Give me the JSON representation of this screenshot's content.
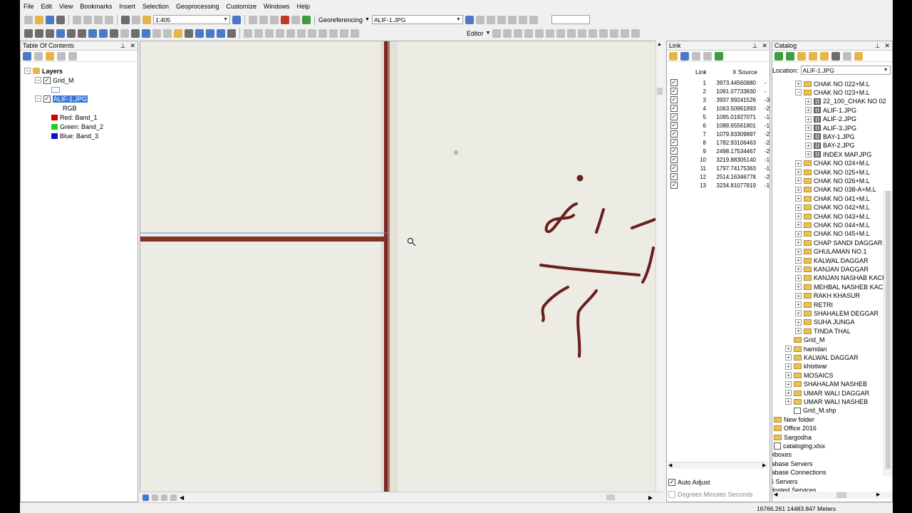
{
  "menu": [
    "File",
    "Edit",
    "View",
    "Bookmarks",
    "Insert",
    "Selection",
    "Geoprocessing",
    "Customize",
    "Windows",
    "Help"
  ],
  "toolbar": {
    "scale": "1:405",
    "georef_label": "Georeferencing",
    "georef_layer": "ALIF-1.JPG",
    "editor_label": "Editor"
  },
  "toc": {
    "title": "Table Of Contents",
    "layers_label": "Layers",
    "layer1": "Grid_M",
    "layer2": "ALIF-1.JPG",
    "rgb": "RGB",
    "red": "Red:   Band_1",
    "green": "Green: Band_2",
    "blue": "Blue:  Band_3"
  },
  "link": {
    "title": "Link",
    "col_link": "Link",
    "col_x": "X Source",
    "rows": [
      {
        "n": "1",
        "x": "3973.44560880",
        "t": "-"
      },
      {
        "n": "2",
        "x": "1091.07733830",
        "t": "-"
      },
      {
        "n": "3",
        "x": "3937.99241526",
        "t": "-3"
      },
      {
        "n": "4",
        "x": "1063.50961893",
        "t": "-2"
      },
      {
        "n": "5",
        "x": "1095.01927071",
        "t": "-1"
      },
      {
        "n": "6",
        "x": "1088.65561801",
        "t": "-1"
      },
      {
        "n": "7",
        "x": "1079.93309897",
        "t": "-2"
      },
      {
        "n": "8",
        "x": "1782.93106463",
        "t": "-2"
      },
      {
        "n": "9",
        "x": "2498.17534467",
        "t": "-2"
      },
      {
        "n": "10",
        "x": "3219.88305140",
        "t": "-1"
      },
      {
        "n": "11",
        "x": "1797.74175363",
        "t": "-1"
      },
      {
        "n": "12",
        "x": "2514.16346778",
        "t": "-2"
      },
      {
        "n": "13",
        "x": "3234.81077819",
        "t": "-1"
      }
    ],
    "auto_adjust": "Auto Adjust",
    "dms": "Degrees Minutes Seconds"
  },
  "catalog": {
    "title": "Catalog",
    "location_label": "Location:",
    "location_value": "ALIF-1.JPG",
    "items": [
      {
        "label": "CHAK NO 022+M.L",
        "kind": "folder",
        "exp": "+"
      },
      {
        "label": "CHAK NO 023+M.L",
        "kind": "folder",
        "exp": "-"
      },
      {
        "label": "22_100_CHAK NO 02",
        "kind": "raster",
        "exp": "+"
      },
      {
        "label": "ALIF-1.JPG",
        "kind": "raster",
        "exp": "+"
      },
      {
        "label": "ALIF-2.JPG",
        "kind": "raster",
        "exp": "+"
      },
      {
        "label": "ALIF-3.JPG",
        "kind": "raster",
        "exp": "+"
      },
      {
        "label": "BAY-1.JPG",
        "kind": "raster",
        "exp": "+"
      },
      {
        "label": "BAY-2.JPG",
        "kind": "raster",
        "exp": "+"
      },
      {
        "label": "INDEX MAP.JPG",
        "kind": "raster",
        "exp": "+"
      },
      {
        "label": "CHAK NO 024+M.L",
        "kind": "folder",
        "exp": "+"
      },
      {
        "label": "CHAK NO 025+M.L",
        "kind": "folder",
        "exp": "+"
      },
      {
        "label": "CHAK NO 026+M.L",
        "kind": "folder",
        "exp": "+"
      },
      {
        "label": "CHAK NO 038-A+M.L",
        "kind": "folder",
        "exp": "+"
      },
      {
        "label": "CHAK NO 041+M.L",
        "kind": "folder",
        "exp": "+"
      },
      {
        "label": "CHAK NO 042+M.L",
        "kind": "folder",
        "exp": "+"
      },
      {
        "label": "CHAK NO 043+M.L",
        "kind": "folder",
        "exp": "+"
      },
      {
        "label": "CHAK NO 044+M.L",
        "kind": "folder",
        "exp": "+"
      },
      {
        "label": "CHAK NO 045+M.L",
        "kind": "folder",
        "exp": "+"
      },
      {
        "label": "CHAP SANDI DAGGAR",
        "kind": "folder",
        "exp": "+"
      },
      {
        "label": "GHULAMAN NO.1",
        "kind": "folder",
        "exp": "+"
      },
      {
        "label": "KALWAL DAGGAR",
        "kind": "folder",
        "exp": "+"
      },
      {
        "label": "KANJAN DAGGAR",
        "kind": "folder",
        "exp": "+"
      },
      {
        "label": "KANJAN NASHAB KACH",
        "kind": "folder",
        "exp": "+"
      },
      {
        "label": "MEHBAL NASHEB KACH",
        "kind": "folder",
        "exp": "+"
      },
      {
        "label": "RAKH KHASUR",
        "kind": "folder",
        "exp": "+"
      },
      {
        "label": "RETRI",
        "kind": "folder",
        "exp": "+"
      },
      {
        "label": "SHAHALEM DEGGAR",
        "kind": "folder",
        "exp": "+"
      },
      {
        "label": "SUHA JUNGA",
        "kind": "folder",
        "exp": "+"
      },
      {
        "label": "TINDA THAL",
        "kind": "folder",
        "exp": "+"
      },
      {
        "label": "Grid_M",
        "kind": "folder",
        "exp": ""
      },
      {
        "label": "hamdan",
        "kind": "folder",
        "exp": "+"
      },
      {
        "label": "KALWAL DAGGAR",
        "kind": "folder",
        "exp": "+"
      },
      {
        "label": "khistwar",
        "kind": "folder",
        "exp": "+"
      },
      {
        "label": "MOSAICS",
        "kind": "folder",
        "exp": "+"
      },
      {
        "label": "SHAHALAM NASHEB",
        "kind": "folder",
        "exp": "+"
      },
      {
        "label": "UMAR WALI DAGGAR",
        "kind": "folder",
        "exp": "+"
      },
      {
        "label": "UMAR WALI NASHEB",
        "kind": "folder",
        "exp": "+"
      },
      {
        "label": "Grid_M.shp",
        "kind": "shp",
        "exp": ""
      },
      {
        "label": "New folder",
        "kind": "folder",
        "exp": ""
      },
      {
        "label": "Office 2016",
        "kind": "folder",
        "exp": ""
      },
      {
        "label": "Sargodha",
        "kind": "folder",
        "exp": ""
      },
      {
        "label": "cataloging.xlsx",
        "kind": "xls",
        "exp": ""
      },
      {
        "label": "olboxes",
        "kind": "none",
        "exp": ""
      },
      {
        "label": "tabase Servers",
        "kind": "none",
        "exp": ""
      },
      {
        "label": "tabase Connections",
        "kind": "none",
        "exp": ""
      },
      {
        "label": "S Servers",
        "kind": "none",
        "exp": ""
      },
      {
        "label": "Hosted Services",
        "kind": "none",
        "exp": ""
      }
    ]
  },
  "status": {
    "coords": "16766.261  14483.847 Meters"
  }
}
